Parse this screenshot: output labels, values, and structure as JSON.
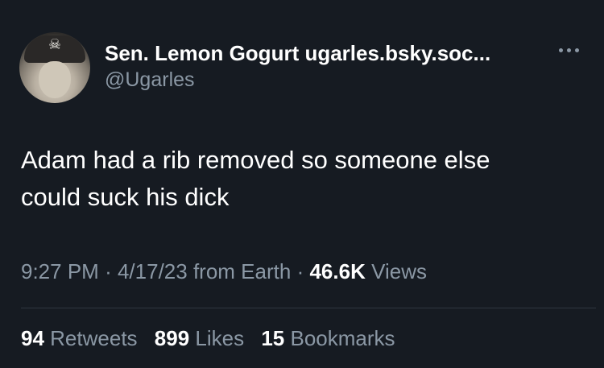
{
  "author": {
    "display_name": "Sen. Lemon Gogurt ugarles.bsky.soc...",
    "handle": "@Ugarles"
  },
  "tweet": {
    "text_line1": "Adam had a rib removed so someone else",
    "text_line2": "could suck his dick"
  },
  "meta": {
    "time": "9:27 PM",
    "sep1": "·",
    "date": "4/17/23",
    "source": "from Earth",
    "sep2": "·",
    "views_count": "46.6K",
    "views_label": "Views"
  },
  "stats": {
    "retweets_count": "94",
    "retweets_label": "Retweets",
    "likes_count": "899",
    "likes_label": "Likes",
    "bookmarks_count": "15",
    "bookmarks_label": "Bookmarks"
  },
  "icons": {
    "more": "more-horizontal-icon",
    "avatar_emblem": "skull-crossbones-icon"
  },
  "colors": {
    "background": "#161b22",
    "primary_text": "#ffffff",
    "secondary_text": "#8b98a5",
    "divider": "#2f3640"
  }
}
